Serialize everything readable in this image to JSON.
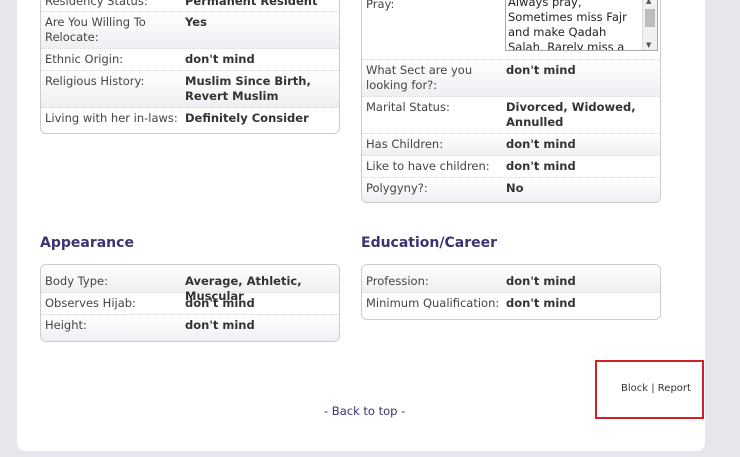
{
  "left_card": {
    "rows": [
      {
        "label": "Residency Status:",
        "value": "Permanent Resident"
      },
      {
        "label": "Are You Willing To Relocate:",
        "value": "Yes"
      },
      {
        "label": "Ethnic Origin:",
        "value": "don't mind"
      },
      {
        "label": "Religious History:",
        "value": "Muslim Since Birth, Revert Muslim"
      },
      {
        "label": "Living with her in-laws:",
        "value": "Definitely Consider"
      }
    ]
  },
  "right_card": {
    "pray_label": "Pray:",
    "pray_value": "Always pray, Sometimes miss Fajr and make Qadah Salah, Rarely miss a prayer and make",
    "rows": [
      {
        "label": "What Sect are you looking for?:",
        "value": "don't mind"
      },
      {
        "label": "Marital Status:",
        "value": "Divorced, Widowed, Annulled"
      },
      {
        "label": "Has Children:",
        "value": "don't mind"
      },
      {
        "label": "Like to have children:",
        "value": "don't mind"
      },
      {
        "label": "Polygyny?:",
        "value": "No"
      }
    ]
  },
  "appearance": {
    "title": "Appearance",
    "rows": [
      {
        "label": "Body Type:",
        "value": "Average, Athletic, Muscular"
      },
      {
        "label": "Observes Hijab:",
        "value": "don't mind"
      },
      {
        "label": "Height:",
        "value": "don't mind"
      }
    ]
  },
  "education": {
    "title": "Education/Career",
    "rows": [
      {
        "label": "Profession:",
        "value": "don't mind"
      },
      {
        "label": "Minimum Qualification:",
        "value": "don't mind"
      }
    ]
  },
  "actions": {
    "block": "Block",
    "separator": "|",
    "report": "Report"
  },
  "back_to_top": "- Back to top -"
}
